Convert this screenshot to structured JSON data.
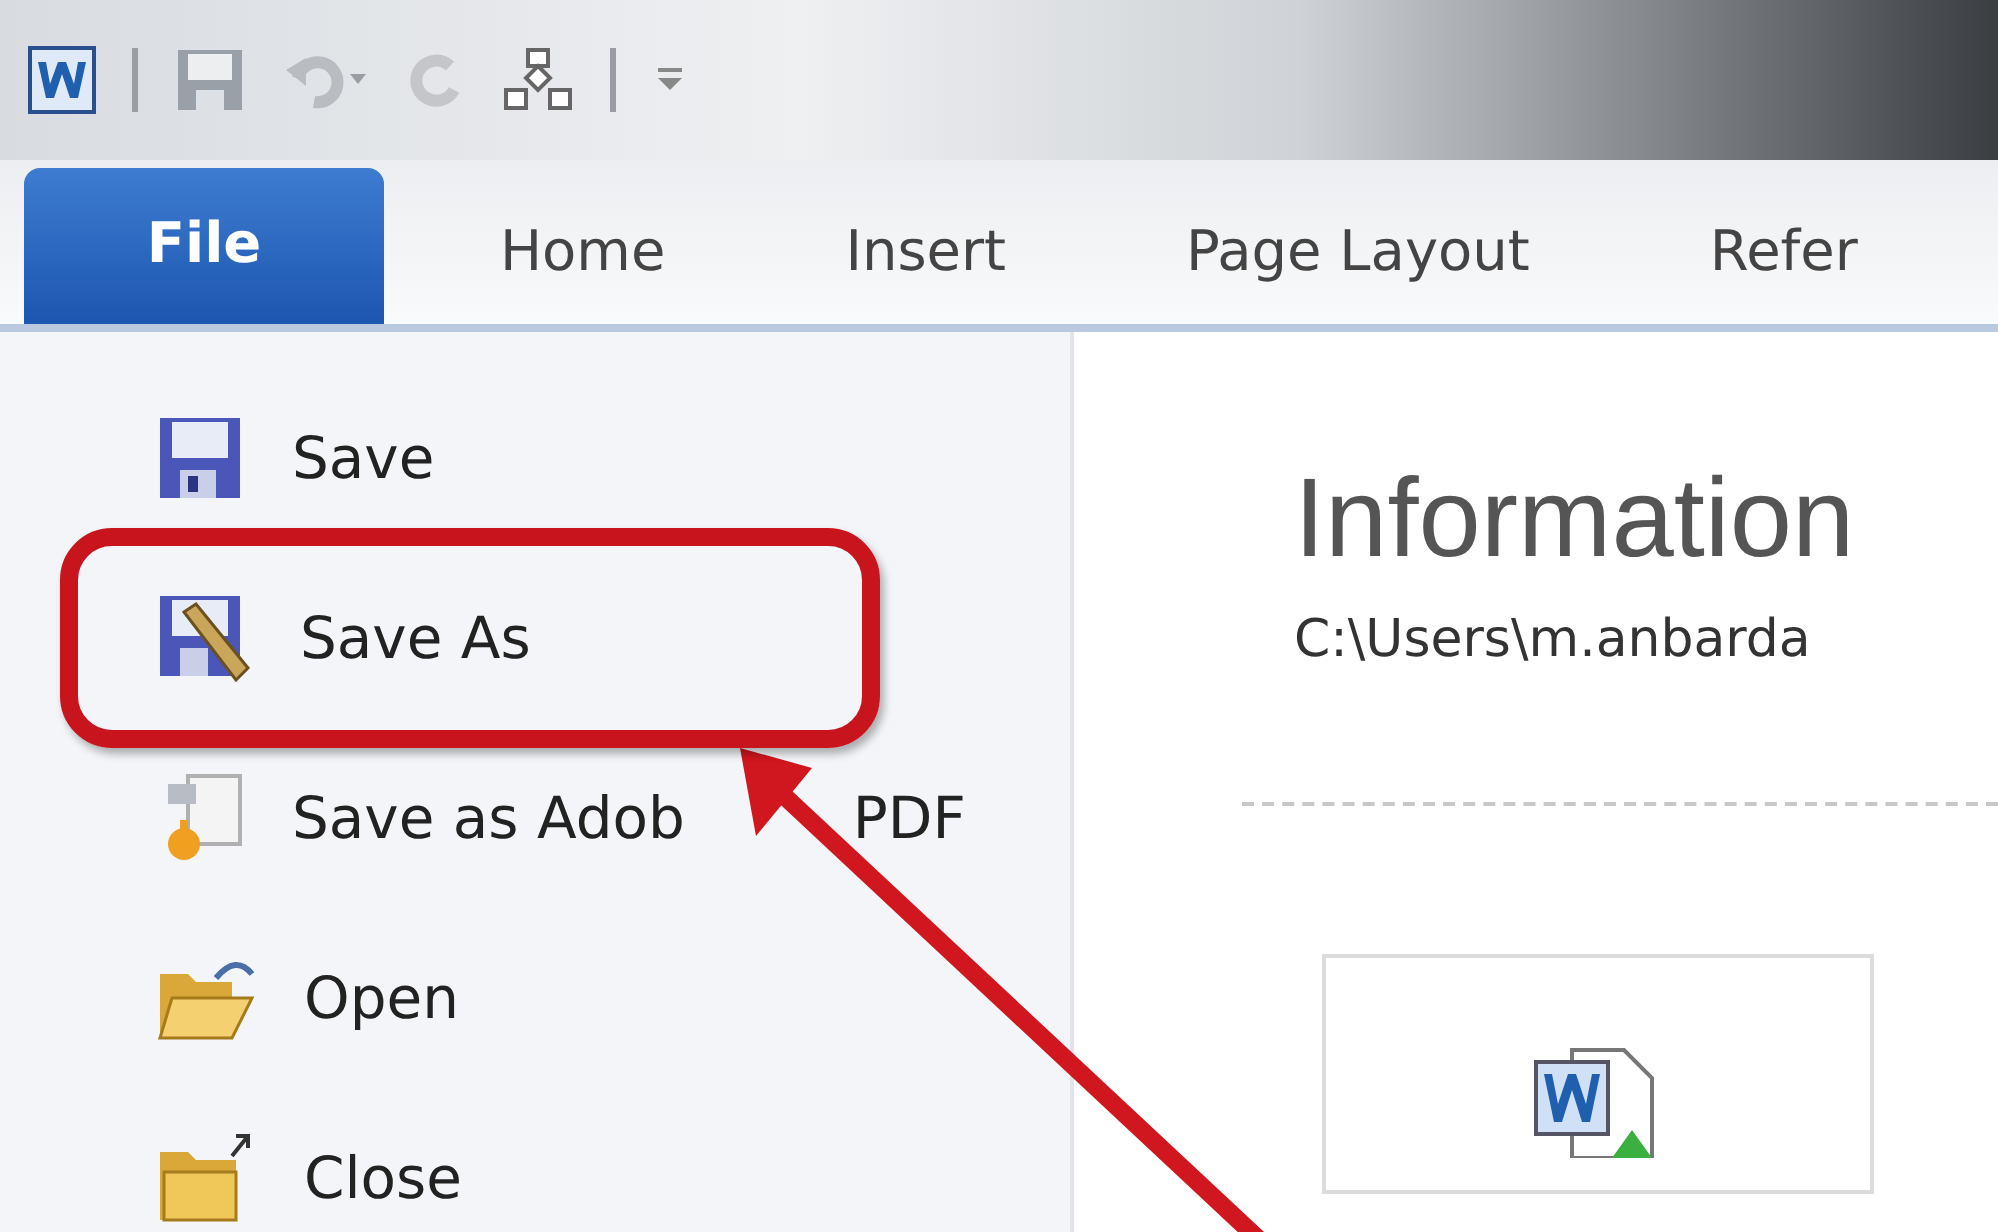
{
  "tabs": [
    {
      "label": "File",
      "selected": true
    },
    {
      "label": "Home",
      "selected": false
    },
    {
      "label": "Insert",
      "selected": false
    },
    {
      "label": "Page Layout",
      "selected": false
    },
    {
      "label": "Refer",
      "selected": false
    }
  ],
  "menu_items": [
    {
      "kind": "save",
      "label": "Save",
      "highlighted": false
    },
    {
      "kind": "saveas",
      "label": "Save As",
      "highlighted": true
    },
    {
      "kind": "export",
      "label": "Save as Adob",
      "label_tail": "PDF",
      "highlighted": false
    },
    {
      "kind": "open",
      "label": "Open",
      "highlighted": false
    },
    {
      "kind": "close",
      "label": "Close",
      "highlighted": false
    }
  ],
  "info": {
    "title": "Information",
    "path": "C:\\Users\\m.anbarda"
  }
}
